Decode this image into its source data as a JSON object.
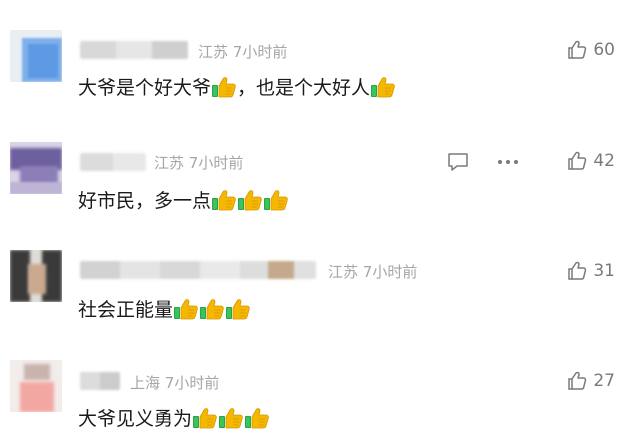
{
  "comments": [
    {
      "location": "江苏",
      "time": "7小时前",
      "text": "大爷是个好大爷",
      "text2": "，也是个大好人",
      "likes": "60"
    },
    {
      "location": "江苏",
      "time": "7小时前",
      "text": "好市民，多一点",
      "likes": "42"
    },
    {
      "location": "江苏",
      "time": "7小时前",
      "text": "社会正能量",
      "likes": "31"
    },
    {
      "location": "上海",
      "time": "7小时前",
      "text": "大爷见义勇为",
      "likes": "27"
    }
  ],
  "colors": {
    "meta_text": "#a6a6a6",
    "like_text": "#7a7a7a",
    "content_text": "#1a1a1a"
  },
  "icons": {
    "like": "thumbs-up-outline-icon",
    "reply": "comment-bubble-icon",
    "more": "ellipsis-icon",
    "emoji": "thumbs-up-emoji"
  }
}
